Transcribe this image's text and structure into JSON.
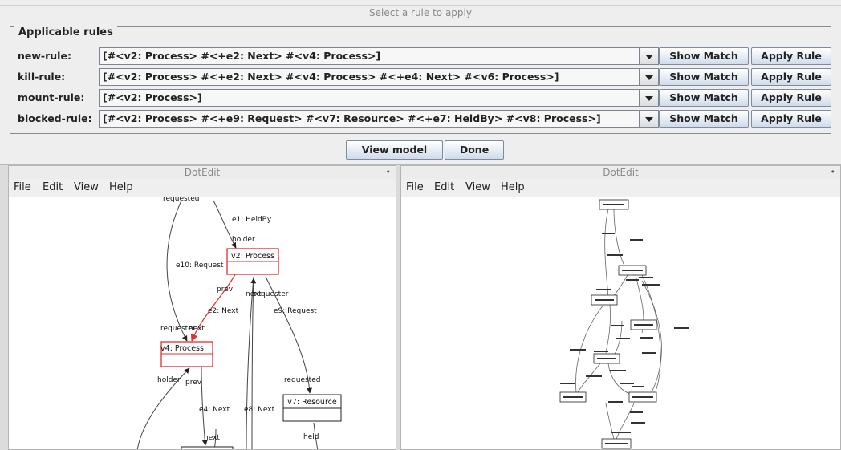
{
  "dialog": {
    "title": "Select a rule to apply",
    "panel_title": "Applicable rules",
    "rules": [
      {
        "name": "new-rule:",
        "pattern": "[#<v2: Process> #<+e2: Next> #<v4: Process>]"
      },
      {
        "name": "kill-rule:",
        "pattern": "[#<v2: Process> #<+e2: Next> #<v4: Process> #<+e4: Next> #<v6: Process>]"
      },
      {
        "name": "mount-rule:",
        "pattern": "[#<v2: Process>]"
      },
      {
        "name": "blocked-rule:",
        "pattern": "[#<v2: Process> #<+e9: Request> #<v7: Resource> #<+e7: HeldBy> #<v8: Process>]"
      }
    ],
    "show_match_label": "Show Match",
    "apply_rule_label": "Apply Rule",
    "view_model_label": "View model",
    "done_label": "Done"
  },
  "left_window": {
    "title": "DotEdit",
    "menu": [
      "File",
      "Edit",
      "View",
      "Help"
    ],
    "graph": {
      "nodes": [
        "v2: Process",
        "v4: Process",
        "v7: Resource"
      ],
      "edges": [
        "requested",
        "e1: HeldBy",
        "holder",
        "e10: Request",
        "prev",
        "next",
        "requester",
        "e2: Next",
        "e9: Request",
        "requester",
        "next",
        "holder",
        "prev",
        "requested",
        "e4: Next",
        "e8: Next",
        "next",
        "held"
      ]
    }
  },
  "right_window": {
    "title": "DotEdit",
    "menu": [
      "File",
      "Edit",
      "View",
      "Help"
    ]
  },
  "colors": {
    "highlight": "#e03030",
    "button_top": "#ffffff",
    "button_bottom": "#cfdcea"
  }
}
